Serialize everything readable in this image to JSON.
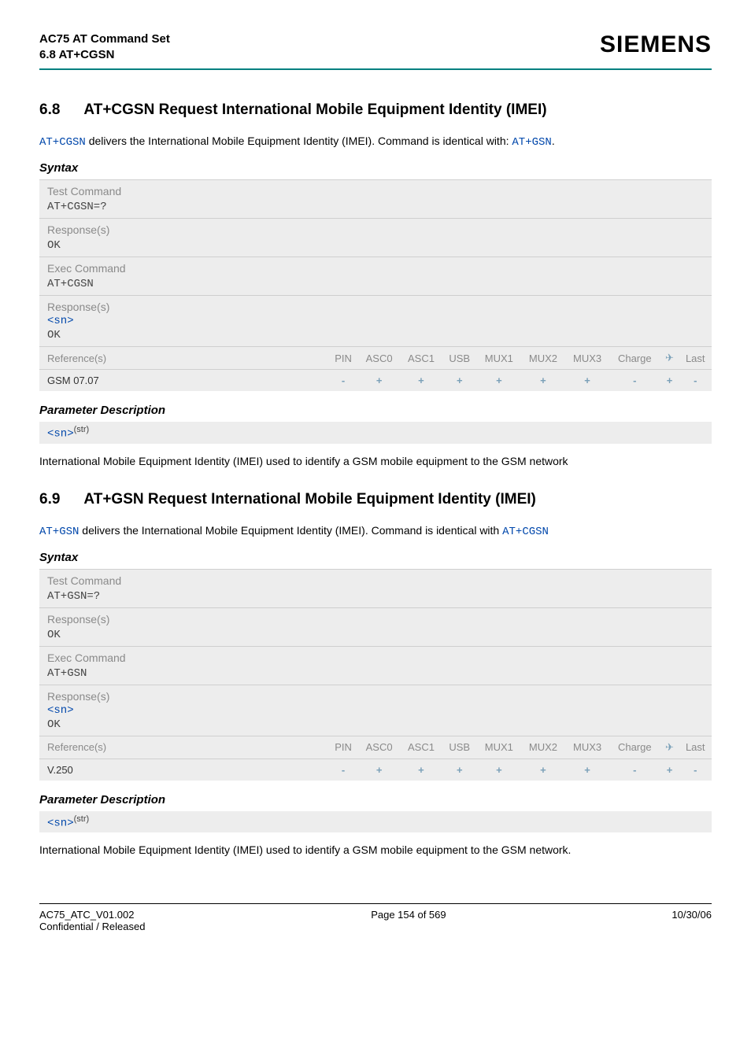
{
  "header": {
    "title_line1": "AC75 AT Command Set",
    "title_line2": "6.8 AT+CGSN",
    "brand": "SIEMENS"
  },
  "section1": {
    "num": "6.8",
    "title": "AT+CGSN   Request International Mobile Equipment Identity (IMEI)",
    "intro_pre": "AT+CGSN",
    "intro_mid": " delivers the International Mobile Equipment Identity (IMEI). Command is identical with: ",
    "intro_link": "AT+GSN",
    "intro_post": ".",
    "syntax_label": "Syntax",
    "test_cmd_label": "Test Command",
    "test_cmd": "AT+CGSN=?",
    "resp_label": "Response(s)",
    "resp_ok": "OK",
    "exec_cmd_label": "Exec Command",
    "exec_cmd": "AT+CGSN",
    "exec_resp_sn": "<sn>",
    "ref_label": "Reference(s)",
    "ref_value": "GSM 07.07",
    "cols": [
      "PIN",
      "ASC0",
      "ASC1",
      "USB",
      "MUX1",
      "MUX2",
      "MUX3",
      "Charge",
      "",
      "Last"
    ],
    "vals": [
      "-",
      "+",
      "+",
      "+",
      "+",
      "+",
      "+",
      "-",
      "+",
      "-"
    ],
    "param_label": "Parameter Description",
    "param_sn": "<sn>",
    "param_sup": "(str)",
    "param_text": "International Mobile Equipment Identity (IMEI) used to identify a GSM mobile equipment to the GSM network"
  },
  "section2": {
    "num": "6.9",
    "title": "AT+GSN   Request International Mobile Equipment Identity (IMEI)",
    "intro_pre": "AT+GSN",
    "intro_mid": " delivers the International Mobile Equipment Identity (IMEI). Command is identical with ",
    "intro_link": "AT+CGSN",
    "intro_post": "",
    "syntax_label": "Syntax",
    "test_cmd_label": "Test Command",
    "test_cmd": "AT+GSN=?",
    "resp_label": "Response(s)",
    "resp_ok": "OK",
    "exec_cmd_label": "Exec Command",
    "exec_cmd": "AT+GSN",
    "exec_resp_sn": "<sn>",
    "ref_label": "Reference(s)",
    "ref_value": "V.250",
    "cols": [
      "PIN",
      "ASC0",
      "ASC1",
      "USB",
      "MUX1",
      "MUX2",
      "MUX3",
      "Charge",
      "",
      "Last"
    ],
    "vals": [
      "-",
      "+",
      "+",
      "+",
      "+",
      "+",
      "+",
      "-",
      "+",
      "-"
    ],
    "param_label": "Parameter Description",
    "param_sn": "<sn>",
    "param_sup": "(str)",
    "param_text": "International Mobile Equipment Identity (IMEI) used to identify a GSM mobile equipment to the GSM network."
  },
  "footer": {
    "left_line1": "AC75_ATC_V01.002",
    "left_line2": "Confidential / Released",
    "center": "Page 154 of 569",
    "right": "10/30/06"
  }
}
